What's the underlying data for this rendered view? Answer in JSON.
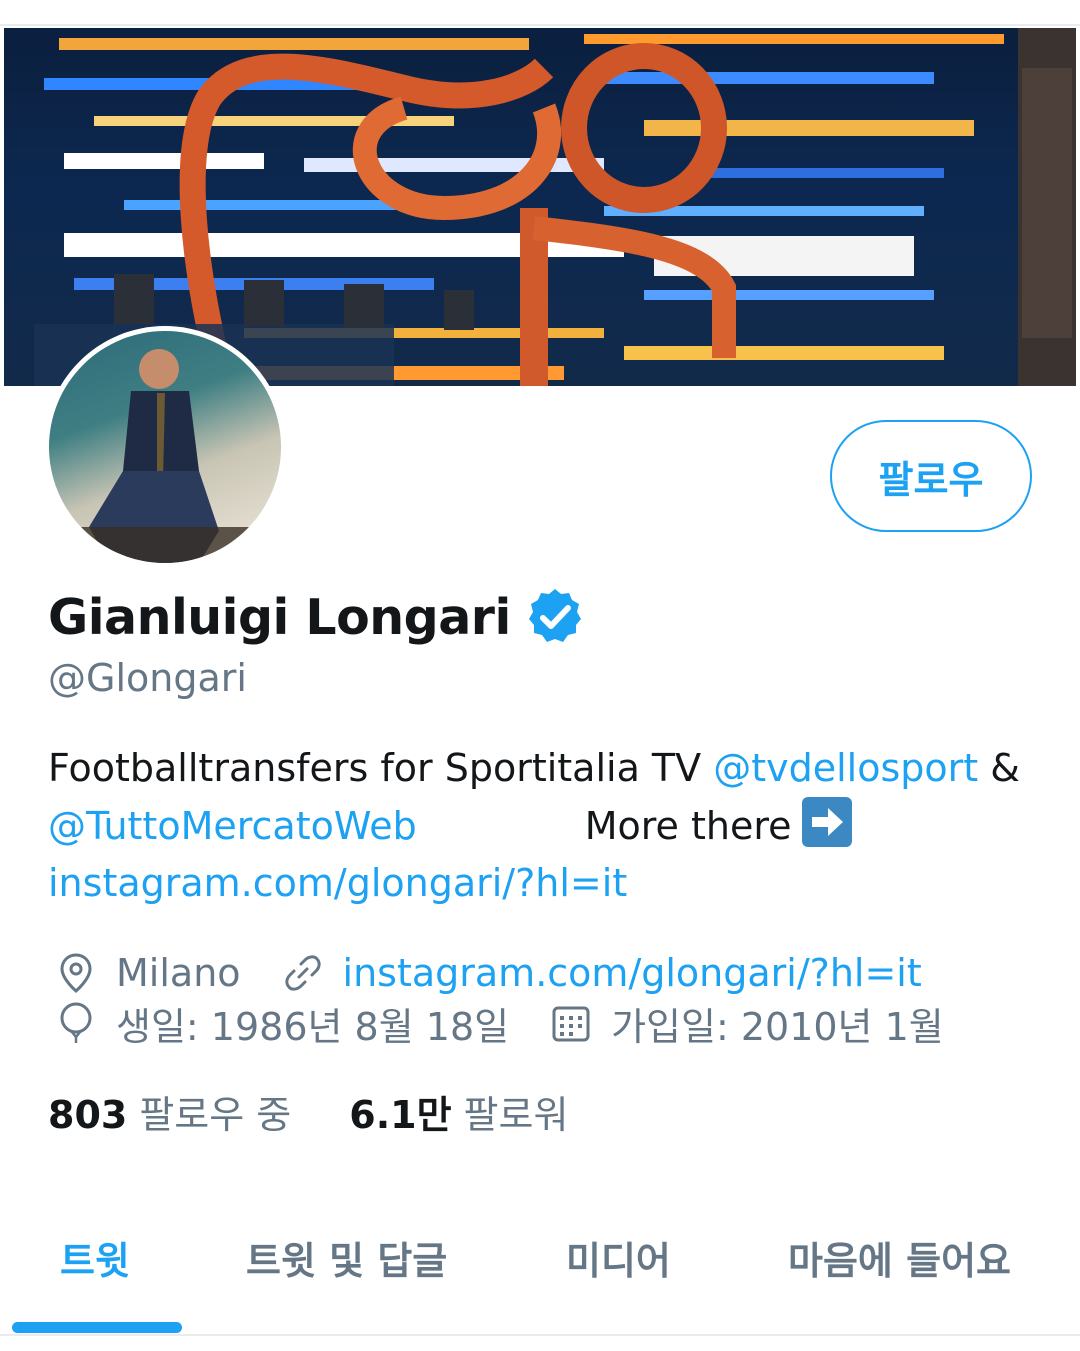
{
  "profile": {
    "display_name": "Gianluigi Longari",
    "handle": "@Glongari",
    "verified": true,
    "follow_label": "팔로우"
  },
  "bio": {
    "text_1": "Footballtransfers for Sportitalia TV ",
    "mention_1": "@tvdellosport",
    "text_2": " &",
    "mention_2": "@TuttoMercatoWeb",
    "text_3": "More there",
    "link": "instagram.com/glongari/?hl=it"
  },
  "meta": {
    "location": "Milano",
    "website": "instagram.com/glongari/?hl=it",
    "birthday": "생일: 1986년 8월 18일",
    "joined": "가입일: 2010년 1월"
  },
  "stats": {
    "following_count": "803",
    "following_label": "팔로우 중",
    "followers_count": "6.1만",
    "followers_label": "팔로워"
  },
  "tabs": [
    {
      "label": "트윗",
      "active": true
    },
    {
      "label": "트윗 및 답글",
      "active": false
    },
    {
      "label": "미디어",
      "active": false
    },
    {
      "label": "마음에 들어요",
      "active": false
    }
  ],
  "colors": {
    "accent": "#1da1f2",
    "secondary_text": "#657786",
    "primary_text": "#14171a"
  },
  "icons": [
    "verified-badge-icon",
    "location-pin-icon",
    "link-icon",
    "balloon-icon",
    "calendar-icon",
    "right-arrow-emoji"
  ]
}
